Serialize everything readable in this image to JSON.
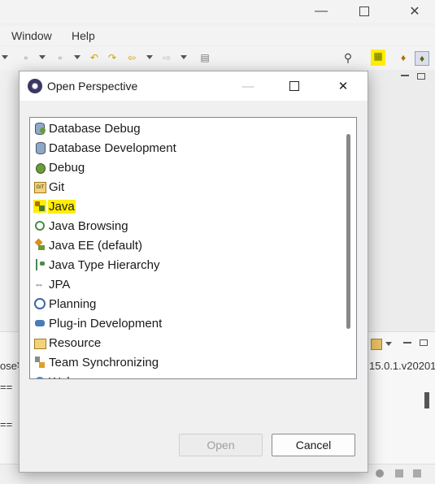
{
  "menu": {
    "window": "Window",
    "help": "Help"
  },
  "dialog": {
    "title": "Open Perspective",
    "perspectives": [
      {
        "label": "Database Debug",
        "icon": "database-debug-icon",
        "highlighted": false
      },
      {
        "label": "Database Development",
        "icon": "database-icon",
        "highlighted": false
      },
      {
        "label": "Debug",
        "icon": "bug-icon",
        "highlighted": false
      },
      {
        "label": "Git",
        "icon": "git-icon",
        "highlighted": false
      },
      {
        "label": "Java",
        "icon": "java-icon",
        "highlighted": true
      },
      {
        "label": "Java Browsing",
        "icon": "java-browsing-icon",
        "highlighted": false
      },
      {
        "label": "Java EE (default)",
        "icon": "java-ee-icon",
        "highlighted": false
      },
      {
        "label": "Java Type Hierarchy",
        "icon": "type-hierarchy-icon",
        "highlighted": false
      },
      {
        "label": "JPA",
        "icon": "jpa-icon",
        "highlighted": false
      },
      {
        "label": "Planning",
        "icon": "planning-icon",
        "highlighted": false
      },
      {
        "label": "Plug-in Development",
        "icon": "plugin-icon",
        "highlighted": false
      },
      {
        "label": "Resource",
        "icon": "resource-icon",
        "highlighted": false
      },
      {
        "label": "Team Synchronizing",
        "icon": "team-sync-icon",
        "highlighted": false
      },
      {
        "label": "Web",
        "icon": "web-icon",
        "highlighted": false
      }
    ],
    "open_label": "Open",
    "cancel_label": "Cancel"
  },
  "background": {
    "left_text": "ose¥",
    "right_text": "15.0.1.v20201",
    "eq_1": "==",
    "eq_2": "=="
  },
  "colors": {
    "highlight": "#ffee00"
  }
}
